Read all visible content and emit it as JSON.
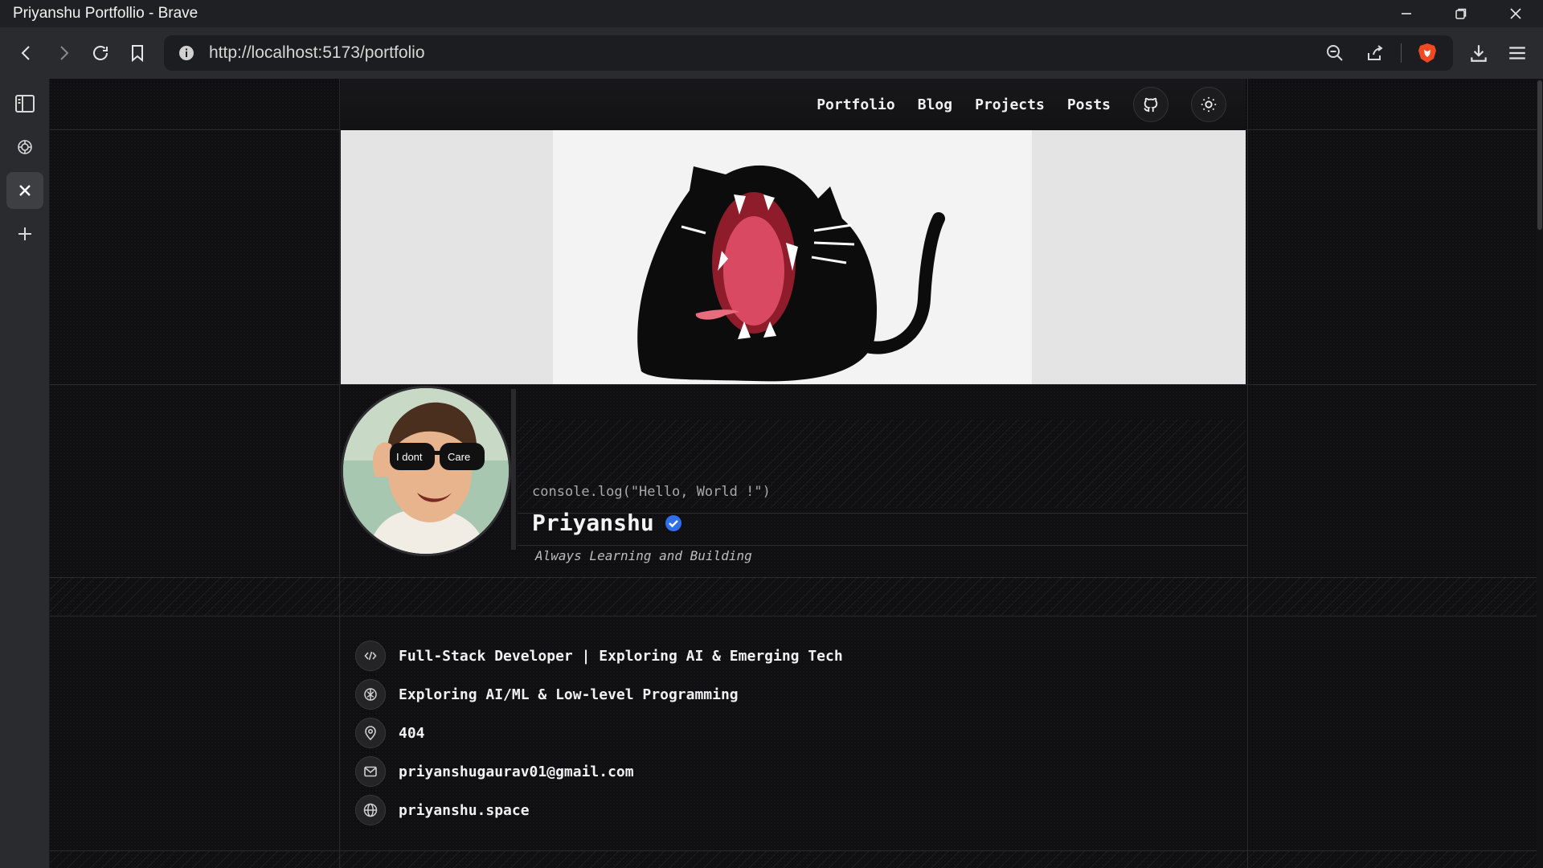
{
  "window": {
    "title": "Priyanshu Portfollio - Brave"
  },
  "toolbar": {
    "url": "http://localhost:5173/portfolio"
  },
  "icons": {
    "back": "back-icon",
    "forward": "forward-icon",
    "reload": "reload-icon",
    "bookmark": "bookmark-icon",
    "info": "info-icon",
    "zoom": "zoom-out-icon",
    "share": "share-icon",
    "brave": "brave-shield-icon",
    "download": "download-icon",
    "menu": "menu-icon"
  },
  "nav": {
    "items": [
      "Portfolio",
      "Blog",
      "Projects",
      "Posts"
    ]
  },
  "profile": {
    "console": "console.log(\"Hello, World !\")",
    "name": "Priyanshu",
    "tagline": "Always Learning and Building",
    "avatar_glasses_left": "I dont",
    "avatar_glasses_right": "Care"
  },
  "info": [
    {
      "icon": "code-icon",
      "text": "Full-Stack Developer | Exploring AI & Emerging Tech"
    },
    {
      "icon": "brain-icon",
      "text": "Exploring AI/ML & Low-level Programming"
    },
    {
      "icon": "map-pin-icon",
      "text": "404"
    },
    {
      "icon": "mail-icon",
      "text": "priyanshugaurav01@gmail.com"
    },
    {
      "icon": "globe-icon",
      "text": "priyanshu.space"
    }
  ],
  "colors": {
    "page_bg": "#0f0f11",
    "accent_verified": "#2f6fec"
  }
}
